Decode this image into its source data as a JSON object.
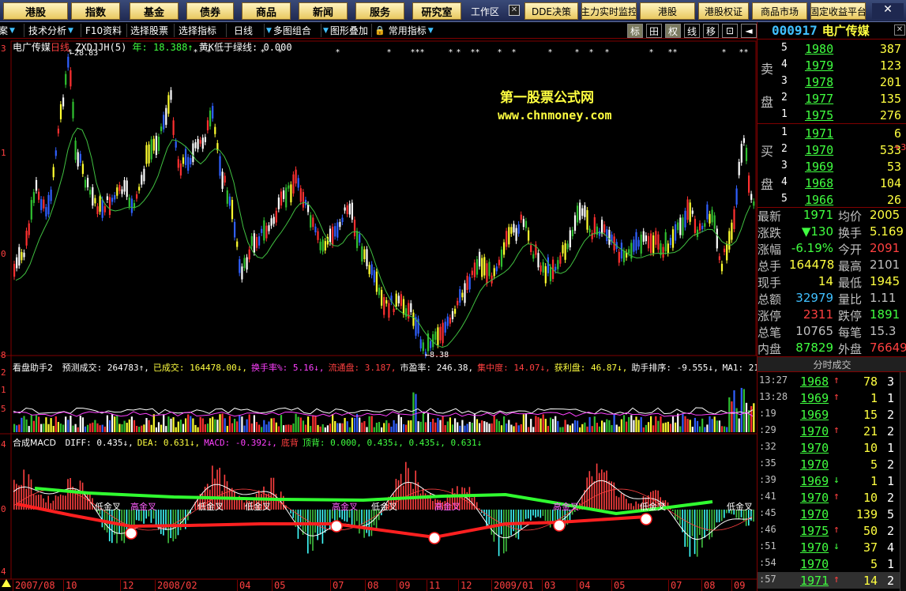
{
  "menubar": {
    "buttons": [
      "港股",
      "指数",
      "基金",
      "债券",
      "商品",
      "新闻",
      "服务",
      "研究室"
    ],
    "workarea": "工作区",
    "right_buttons": [
      "DDE决策",
      "主力实时监控",
      "港股",
      "港股权证",
      "商品市场",
      "固定收益平台"
    ]
  },
  "toolbar": {
    "items": [
      "案",
      "技术分析",
      "F10资料",
      "选择股票",
      "选择指标",
      "日线",
      "多图组合",
      "图形叠加",
      "常用指标"
    ],
    "icons": [
      "标",
      "田",
      "权",
      "线",
      "移",
      "⊡",
      "◄"
    ]
  },
  "main_chart": {
    "title": "电广传媒",
    "period": "日线",
    "formula": "ZXDJJH(5)",
    "year_label": "年: 18.388↑",
    "yellow_label": "黄K低于绿线: 0.000",
    "high_label": "28.83",
    "low_label": "8.38",
    "y_ticks": [
      "3",
      "1",
      "0",
      "8"
    ],
    "watermark_1": "第一股票公式网",
    "watermark_2": "www.chnmoney.com"
  },
  "vol_panel": {
    "label_name": "看盘助手2",
    "items": [
      {
        "t": "预测成交: 264783↑,",
        "c": "#ffffff"
      },
      {
        "t": "已成交: 164478.00↓,",
        "c": "#ffff40"
      },
      {
        "t": "换手率%: 5.16↓,",
        "c": "#ff40ff"
      },
      {
        "t": "流通盘: 3.187,",
        "c": "#ff4040"
      },
      {
        "t": "市盈率: 246.38,",
        "c": "#ffffff"
      },
      {
        "t": "集中度: 14.07↓,",
        "c": "#ff4040"
      },
      {
        "t": "获利盘: 46.87↓,",
        "c": "#ffff40"
      },
      {
        "t": "助手排序: -9.555↓,",
        "c": "#ffffff"
      },
      {
        "t": "MA1: 216151",
        "c": "#ffffff"
      }
    ],
    "y_ticks": [
      "2",
      "1",
      "5"
    ]
  },
  "macd_panel": {
    "label_name": "合成MACD",
    "items": [
      {
        "t": "DIFF: 0.435↓,",
        "c": "#ffffff"
      },
      {
        "t": "DEA: 0.631↓,",
        "c": "#ffff40"
      },
      {
        "t": "MACD: -0.392↓,",
        "c": "#ff40ff"
      },
      {
        "t": "底背",
        "c": "#ff4040"
      },
      {
        "t": "顶背: 0.000, 0.435↓, 0.435↓, 0.631↓",
        "c": "#40ff40"
      }
    ],
    "y_ticks": [
      "4",
      "0",
      "4"
    ],
    "signal_label": "低金叉",
    "signal_label2": "高金叉"
  },
  "x_axis": {
    "labels": [
      "2007/08",
      "10",
      "12",
      "2008/02",
      "04",
      "05",
      "07",
      "08",
      "09",
      "11",
      "12",
      "2009/01",
      "03",
      "04",
      "05",
      "07",
      "08",
      "09"
    ]
  },
  "stock": {
    "code": "000917",
    "name": "电广传媒"
  },
  "orderbook": {
    "sell_label_1": "卖",
    "sell_label_2": "盘",
    "buy_label_1": "买",
    "buy_label_2": "盘",
    "sell": [
      {
        "lvl": "5",
        "price": "1980",
        "vol": "387"
      },
      {
        "lvl": "4",
        "price": "1979",
        "vol": "123"
      },
      {
        "lvl": "3",
        "price": "1978",
        "vol": "201"
      },
      {
        "lvl": "2",
        "price": "1977",
        "vol": "135"
      },
      {
        "lvl": "1",
        "price": "1975",
        "vol": "276"
      }
    ],
    "buy": [
      {
        "lvl": "1",
        "price": "1971",
        "vol": "6"
      },
      {
        "lvl": "2",
        "price": "1970",
        "vol": "533"
      },
      {
        "lvl": "3",
        "price": "1969",
        "vol": "53"
      },
      {
        "lvl": "4",
        "price": "1968",
        "vol": "104"
      },
      {
        "lvl": "5",
        "price": "1966",
        "vol": "26"
      }
    ],
    "buy_extra": "+3"
  },
  "quote": [
    {
      "k1": "最新",
      "v1": "1971",
      "c1": "#40ff40",
      "k2": "均价",
      "v2": "2005",
      "c2": "#ffff40"
    },
    {
      "k1": "涨跌",
      "v1": "▼130",
      "c1": "#40ff40",
      "k2": "换手",
      "v2": "5.169",
      "c2": "#ffff40"
    },
    {
      "k1": "涨幅",
      "v1": "-6.19%",
      "c1": "#40ff40",
      "k2": "今开",
      "v2": "2091",
      "c2": "#ff4040"
    },
    {
      "k1": "总手",
      "v1": "164478",
      "c1": "#ffff40",
      "k2": "最高",
      "v2": "2101",
      "c2": "#c0c0c0"
    },
    {
      "k1": "现手",
      "v1": "14",
      "c1": "#ffff40",
      "k2": "最低",
      "v2": "1945",
      "c2": "#ffff40"
    },
    {
      "k1": "总额",
      "v1": "32979",
      "c1": "#40c0ff",
      "k2": "量比",
      "v2": "1.11",
      "c2": "#c0c0c0"
    },
    {
      "k1": "涨停",
      "v1": "2311",
      "c1": "#ff4040",
      "k2": "跌停",
      "v2": "1891",
      "c2": "#40ff40"
    },
    {
      "k1": "总笔",
      "v1": "10765",
      "c1": "#c0c0c0",
      "k2": "每笔",
      "v2": "15.3",
      "c2": "#c0c0c0"
    },
    {
      "k1": "内盘",
      "v1": "87829",
      "c1": "#40ff40",
      "k2": "外盘",
      "v2": "76649",
      "c2": "#ff4040"
    }
  ],
  "ticks_header": "分时成交",
  "ticks": [
    {
      "time": "13:27",
      "price": "1968",
      "arrow": "↑",
      "ac": "#ff4040",
      "vol": "78",
      "side": "3"
    },
    {
      "time": "13:28",
      "price": "1969",
      "arrow": "↑",
      "ac": "#ff4040",
      "vol": "1",
      "side": "1"
    },
    {
      "time": ":19",
      "price": "1969",
      "arrow": "",
      "ac": "#ff4040",
      "vol": "15",
      "side": "2"
    },
    {
      "time": ":29",
      "price": "1970",
      "arrow": "↑",
      "ac": "#ff4040",
      "vol": "21",
      "side": "2"
    },
    {
      "time": ":32",
      "price": "1970",
      "arrow": "",
      "ac": "#ff4040",
      "vol": "10",
      "side": "1"
    },
    {
      "time": ":35",
      "price": "1970",
      "arrow": "",
      "ac": "#ff4040",
      "vol": "5",
      "side": "2"
    },
    {
      "time": ":39",
      "price": "1969",
      "arrow": "↓",
      "ac": "#40ff40",
      "vol": "1",
      "side": "1"
    },
    {
      "time": ":41",
      "price": "1970",
      "arrow": "↑",
      "ac": "#ff4040",
      "vol": "10",
      "side": "2"
    },
    {
      "time": ":45",
      "price": "1970",
      "arrow": "",
      "ac": "#ff4040",
      "vol": "139",
      "side": "5"
    },
    {
      "time": ":46",
      "price": "1975",
      "arrow": "↑",
      "ac": "#ff4040",
      "vol": "50",
      "side": "2"
    },
    {
      "time": ":51",
      "price": "1970",
      "arrow": "↓",
      "ac": "#40ff40",
      "vol": "37",
      "side": "4"
    },
    {
      "time": ":54",
      "price": "1970",
      "arrow": "",
      "ac": "#ff4040",
      "vol": "5",
      "side": "1"
    },
    {
      "time": ":57",
      "price": "1971",
      "arrow": "↑",
      "ac": "#ff4040",
      "vol": "14",
      "side": "2"
    }
  ]
}
